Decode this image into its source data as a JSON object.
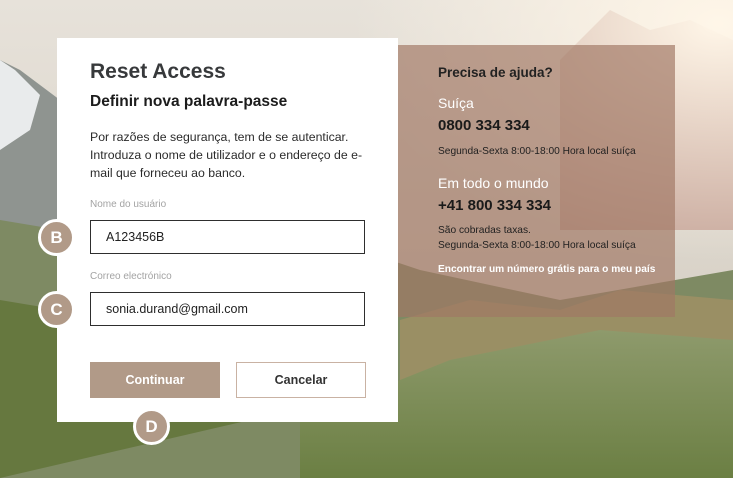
{
  "card": {
    "title": "Reset Access",
    "subtitle": "Definir nova palavra-passe",
    "description": "Por razões de segurança, tem de se autenticar. Introduza o nome de utilizador e o endereço de e-mail que forneceu ao banco.",
    "username_label": "Nome do usuário",
    "username_value": "A123456B",
    "email_label": "Correo electrónico",
    "email_value": "sonia.durand@gmail.com",
    "continue_label": "Continuar",
    "cancel_label": "Cancelar"
  },
  "help": {
    "heading": "Precisa de ajuda?",
    "region1": "Suíça",
    "phone1": "0800 334 334",
    "hours1": "Segunda-Sexta 8:00-18:00 Hora local suíça",
    "region2": "Em todo o mundo",
    "phone2": "+41 800 334 334",
    "fees": "São cobradas taxas.",
    "hours2": "Segunda-Sexta 8:00-18:00 Hora local suíça",
    "link": "Encontrar um número grátis para o meu país"
  },
  "markers": {
    "b": "B",
    "c": "C",
    "d": "D"
  },
  "colors": {
    "accent": "#b19a88",
    "help_panel": "#a07864"
  }
}
